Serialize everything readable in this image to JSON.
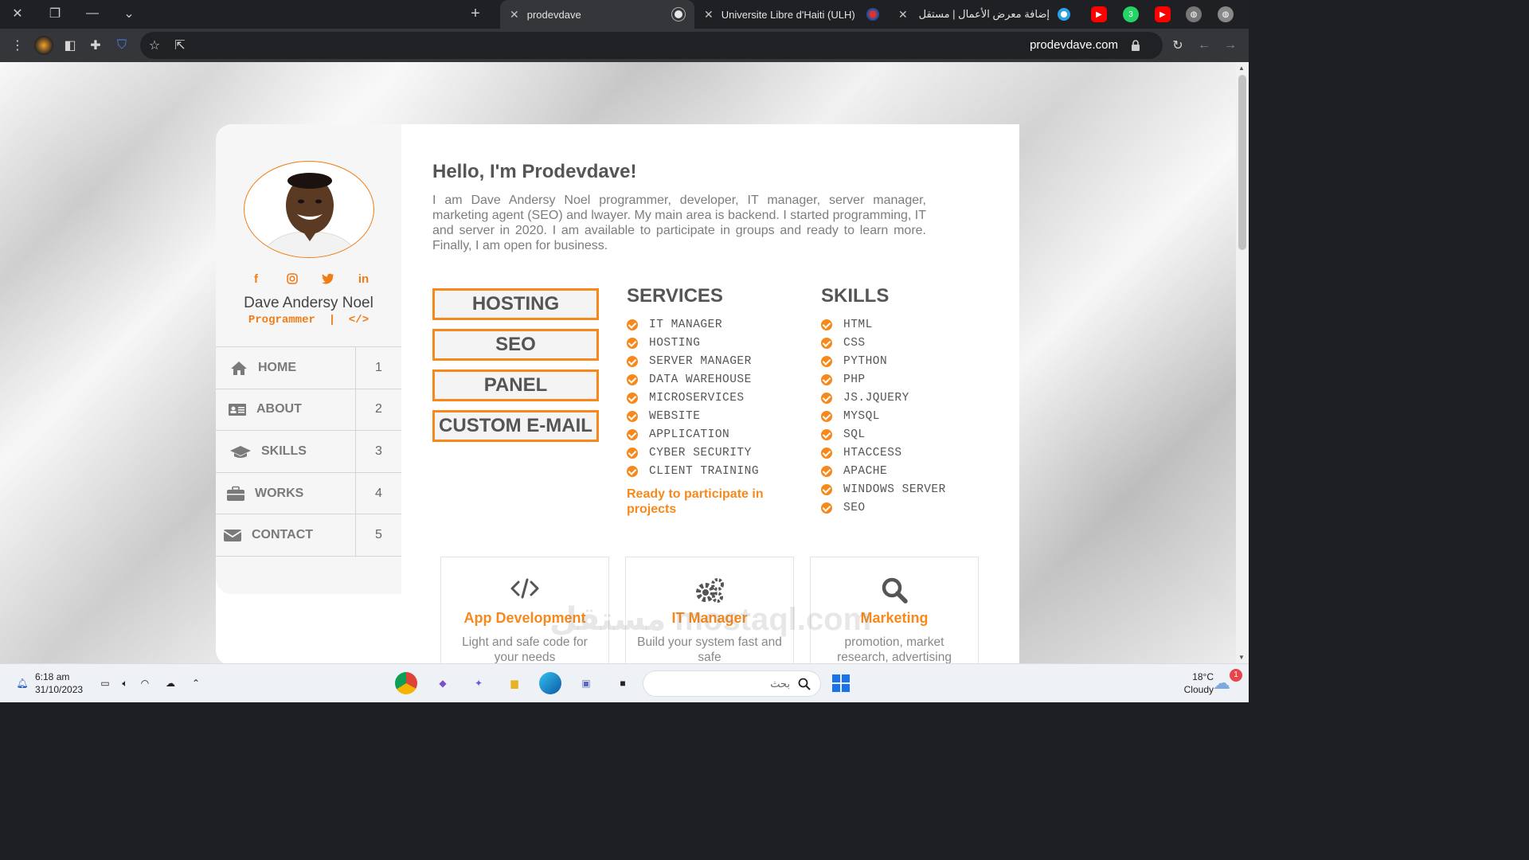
{
  "browser": {
    "tabs": [
      {
        "title": "prodevdave",
        "active": true
      },
      {
        "title": "Universite Libre d'Haiti (ULH)",
        "active": false
      },
      {
        "title": "إضافة معرض الأعمال | مستقل",
        "active": false
      }
    ],
    "url": "prodevdave.com"
  },
  "profile": {
    "name": "Dave Andersy Noel",
    "role": "Programmer",
    "role_sep": "|",
    "role_icon": "</>",
    "socials": [
      "facebook-icon",
      "instagram-icon",
      "twitter-icon",
      "linkedin-icon"
    ]
  },
  "menu": [
    {
      "label": "HOME",
      "num": "1",
      "icon": "home-icon"
    },
    {
      "label": "ABOUT",
      "num": "2",
      "icon": "id-card-icon"
    },
    {
      "label": "SKILLS",
      "num": "3",
      "icon": "graduation-cap-icon"
    },
    {
      "label": "WORKS",
      "num": "4",
      "icon": "briefcase-icon"
    },
    {
      "label": "CONTACT",
      "num": "5",
      "icon": "envelope-icon"
    }
  ],
  "main": {
    "heading": "Hello, I'm Prodevdave!",
    "intro": "I am Dave Andersy Noel programmer, developer, IT manager, server manager, marketing agent (SEO) and lwayer. My main area is backend. I started programming, IT and server in 2020. I am available to participate in groups and ready to learn more. Finally, I am open for business.",
    "buttons": [
      "HOSTING",
      "SEO",
      "PANEL",
      "CUSTOM E-MAIL"
    ],
    "services_title": "SERVICES",
    "services": [
      "IT MANAGER",
      "HOSTING",
      "SERVER MANAGER",
      "DATA WAREHOUSE",
      "MICROSERVICES",
      "WEBSITE",
      "APPLICATION",
      "CYBER SECURITY",
      "CLIENT TRAINING"
    ],
    "ready": "Ready to participate in projects",
    "skills_title": "SKILLS",
    "skills": [
      "HTML",
      "CSS",
      "PYTHON",
      "PHP",
      "JS.JQUERY",
      "MYSQL",
      "SQL",
      "HTACCESS",
      "APACHE",
      "WINDOWS SERVER",
      "SEO"
    ],
    "cards": [
      {
        "icon": "code-icon",
        "title": "App Development",
        "desc": "Light and safe code for your needs"
      },
      {
        "icon": "gears-icon",
        "title": "IT Manager",
        "desc": "Build your system fast and safe"
      },
      {
        "icon": "search-icon",
        "title": "Marketing",
        "desc": "promotion, market research, advertising"
      }
    ]
  },
  "watermark": "مستقل mostaql.com",
  "taskbar": {
    "time": "6:18 am",
    "date": "31/10/2023",
    "search_placeholder": "بحث",
    "temp": "18°C",
    "weather": "Cloudy",
    "notif": "1"
  },
  "colors": {
    "accent": "#f7891c",
    "text": "#555555"
  }
}
